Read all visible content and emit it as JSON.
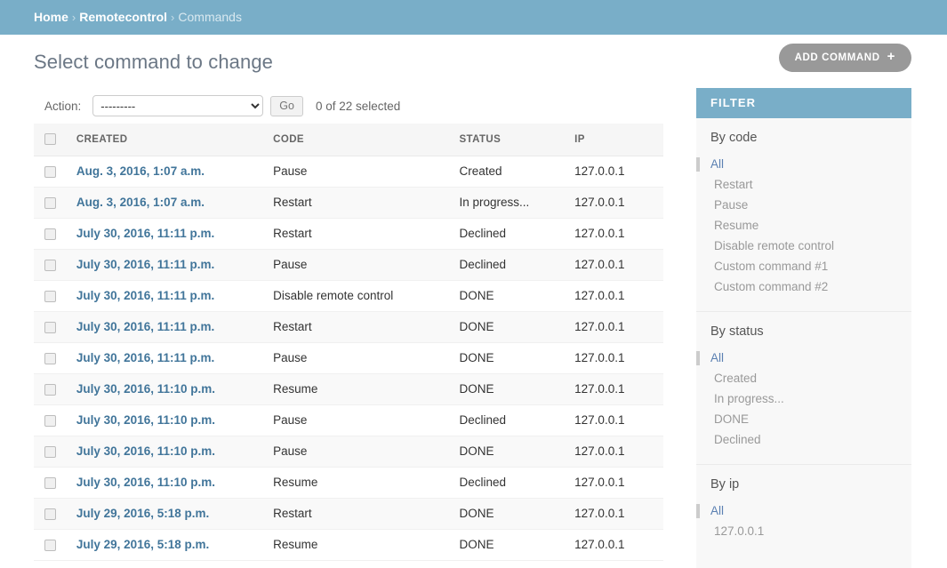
{
  "breadcrumbs": {
    "home": "Home",
    "app": "Remotecontrol",
    "current": "Commands",
    "separator": "›"
  },
  "header": {
    "page_title": "Select command to change",
    "add_button_label": "Add command",
    "add_button_icon": "plus-icon",
    "add_button_glyph": "+"
  },
  "actions": {
    "label": "Action:",
    "selected_option": "---------",
    "options": [
      "---------"
    ],
    "go_label": "Go",
    "counter": "0 of 22 selected"
  },
  "table": {
    "columns": [
      "CREATED",
      "CODE",
      "STATUS",
      "IP"
    ],
    "rows": [
      {
        "created": "Aug. 3, 2016, 1:07 a.m.",
        "code": "Pause",
        "status": "Created",
        "status_class": "status-created",
        "ip": "127.0.0.1"
      },
      {
        "created": "Aug. 3, 2016, 1:07 a.m.",
        "code": "Restart",
        "status": "In progress...",
        "status_class": "status-progress",
        "ip": "127.0.0.1"
      },
      {
        "created": "July 30, 2016, 11:11 p.m.",
        "code": "Restart",
        "status": "Declined",
        "status_class": "status-declined",
        "ip": "127.0.0.1"
      },
      {
        "created": "July 30, 2016, 11:11 p.m.",
        "code": "Pause",
        "status": "Declined",
        "status_class": "status-declined",
        "ip": "127.0.0.1"
      },
      {
        "created": "July 30, 2016, 11:11 p.m.",
        "code": "Disable remote control",
        "status": "DONE",
        "status_class": "status-done",
        "ip": "127.0.0.1"
      },
      {
        "created": "July 30, 2016, 11:11 p.m.",
        "code": "Restart",
        "status": "DONE",
        "status_class": "status-done",
        "ip": "127.0.0.1"
      },
      {
        "created": "July 30, 2016, 11:11 p.m.",
        "code": "Pause",
        "status": "DONE",
        "status_class": "status-done",
        "ip": "127.0.0.1"
      },
      {
        "created": "July 30, 2016, 11:10 p.m.",
        "code": "Resume",
        "status": "DONE",
        "status_class": "status-done",
        "ip": "127.0.0.1"
      },
      {
        "created": "July 30, 2016, 11:10 p.m.",
        "code": "Pause",
        "status": "Declined",
        "status_class": "status-declined",
        "ip": "127.0.0.1"
      },
      {
        "created": "July 30, 2016, 11:10 p.m.",
        "code": "Pause",
        "status": "DONE",
        "status_class": "status-done",
        "ip": "127.0.0.1"
      },
      {
        "created": "July 30, 2016, 11:10 p.m.",
        "code": "Resume",
        "status": "Declined",
        "status_class": "status-declined",
        "ip": "127.0.0.1"
      },
      {
        "created": "July 29, 2016, 5:18 p.m.",
        "code": "Restart",
        "status": "DONE",
        "status_class": "status-done",
        "ip": "127.0.0.1"
      },
      {
        "created": "July 29, 2016, 5:18 p.m.",
        "code": "Resume",
        "status": "DONE",
        "status_class": "status-done",
        "ip": "127.0.0.1"
      }
    ]
  },
  "filter": {
    "title": "Filter",
    "groups": [
      {
        "heading": "By code",
        "items": [
          {
            "label": "All",
            "selected": true
          },
          {
            "label": "Restart",
            "selected": false
          },
          {
            "label": "Pause",
            "selected": false
          },
          {
            "label": "Resume",
            "selected": false
          },
          {
            "label": "Disable remote control",
            "selected": false
          },
          {
            "label": "Custom command #1",
            "selected": false
          },
          {
            "label": "Custom command #2",
            "selected": false
          }
        ]
      },
      {
        "heading": "By status",
        "items": [
          {
            "label": "All",
            "selected": true
          },
          {
            "label": "Created",
            "selected": false
          },
          {
            "label": "In progress...",
            "selected": false
          },
          {
            "label": "DONE",
            "selected": false
          },
          {
            "label": "Declined",
            "selected": false
          }
        ]
      },
      {
        "heading": "By ip",
        "items": [
          {
            "label": "All",
            "selected": true
          },
          {
            "label": "127.0.0.1",
            "selected": false
          }
        ]
      }
    ]
  },
  "colors": {
    "header_blue": "#79aec8",
    "link_blue": "#41759a",
    "status_done": "#00c000",
    "status_declined": "#ef3f3f",
    "status_progress": "#f0ad4e",
    "add_button_gray": "#999999"
  }
}
